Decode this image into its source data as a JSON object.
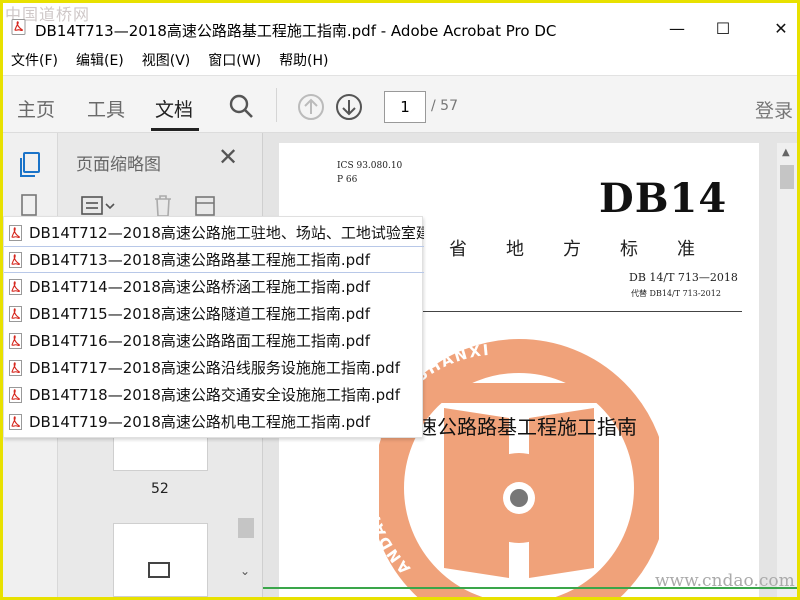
{
  "watermark_top": "中国道桥网",
  "watermark_bottom": "www.cndao.com",
  "window": {
    "title": "DB14T713—2018高速公路路基工程施工指南.pdf - Adobe Acrobat Pro DC",
    "minimize": "—",
    "maximize": "☐",
    "close": "✕"
  },
  "menu": [
    "文件(F)",
    "编辑(E)",
    "视图(V)",
    "窗口(W)",
    "帮助(H)"
  ],
  "toolbar": {
    "tabs": [
      "主页",
      "工具",
      "文档"
    ],
    "active_tab": "文档",
    "page_current": "1",
    "page_total": "/ 57",
    "login": "登录"
  },
  "thumbnail_panel": {
    "title": "页面缩略图",
    "close": "✕",
    "page_label": "52"
  },
  "file_dropdown": [
    "DB14T712—2018高速公路施工驻地、场站、工地试验室建",
    "DB14T713—2018高速公路路基工程施工指南.pdf",
    "DB14T714—2018高速公路桥涵工程施工指南.pdf",
    "DB14T715—2018高速公路隧道工程施工指南.pdf",
    "DB14T716—2018高速公路路面工程施工指南.pdf",
    "DB14T717—2018高速公路沿线服务设施施工指南.pdf",
    "DB14T718—2018高速公路交通安全设施施工指南.pdf",
    "DB14T719—2018高速公路机电工程施工指南.pdf"
  ],
  "selected_file_index": 1,
  "document": {
    "ics": "ICS  93.080.10",
    "p": "P 66",
    "db": "DB14",
    "province_chars": [
      "省",
      "地",
      "方",
      "标",
      "准"
    ],
    "code": "DB 14/T 713—2018",
    "replaces": "代替 DB14/T 713-2012",
    "title": "速公路路基工程施工指南",
    "seal_text": "ANDARDS PRESS OF SHANXI",
    "colors": {
      "seal": "#f0a27a",
      "accent_green": "#3aa64a",
      "pdf_red": "#d6281f"
    }
  }
}
